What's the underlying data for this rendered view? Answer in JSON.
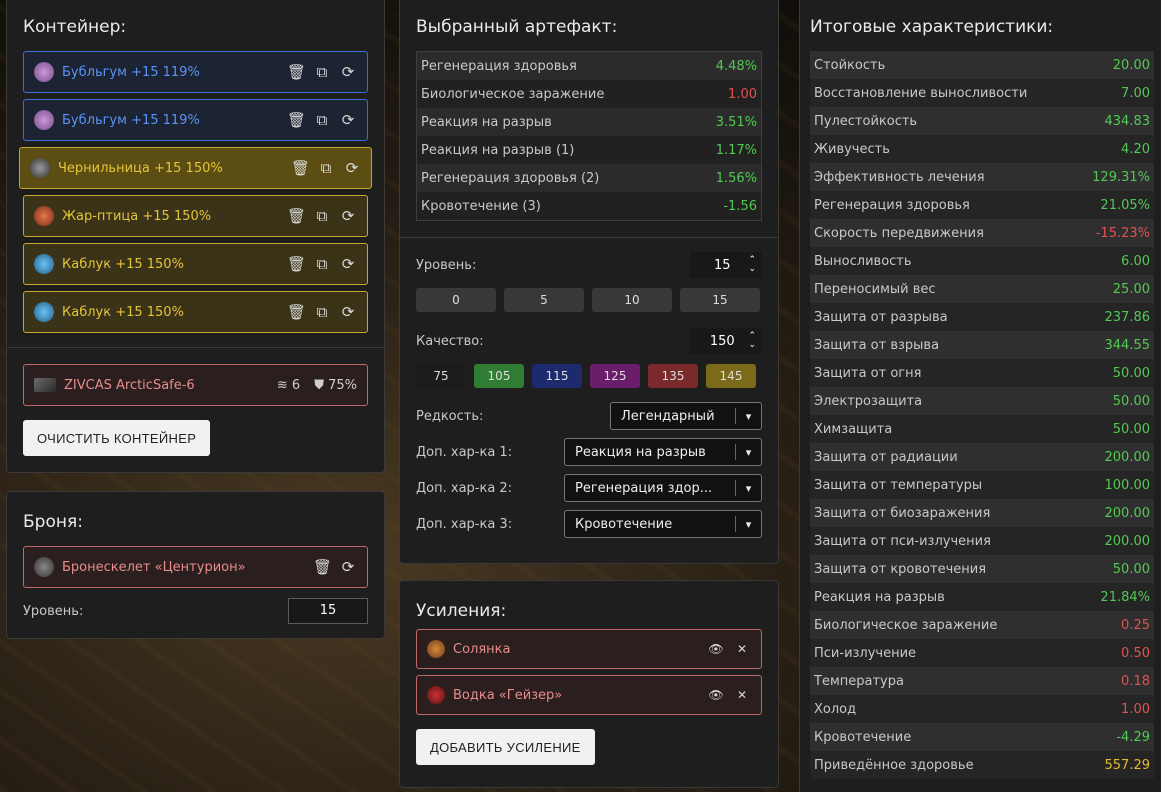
{
  "container": {
    "title": "Контейнер:",
    "artifacts": [
      {
        "name": "Бубльгум +15 119%",
        "color": "blue",
        "icon": "bubblegum-icon"
      },
      {
        "name": "Бубльгум +15 119%",
        "color": "blue",
        "icon": "bubblegum-icon"
      },
      {
        "name": "Чернильница +15 150%",
        "color": "gold",
        "icon": "inkwell-icon"
      },
      {
        "name": "Жар-птица +15 150%",
        "color": "gold",
        "icon": "firebird-icon"
      },
      {
        "name": "Каблук +15 150%",
        "color": "gold",
        "icon": "heel-icon"
      },
      {
        "name": "Каблук +15 150%",
        "color": "gold",
        "icon": "heel-icon"
      }
    ],
    "container_item": {
      "name": "ZIVCAS ArcticSafe-6",
      "slots": "6",
      "protection": "75%"
    },
    "clear_button": "ОЧИСТИТЬ КОНТЕЙНЕР"
  },
  "armor": {
    "title": "Броня:",
    "item_name": "Бронескелет «Центурион»",
    "level_label": "Уровень:",
    "level_value": "15"
  },
  "artifact": {
    "title": "Выбранный артефакт:",
    "stats": [
      {
        "name": "Регенерация здоровья",
        "value": "4.48%",
        "kind": "pos"
      },
      {
        "name": "Биологическое заражение",
        "value": "1.00",
        "kind": "neg"
      },
      {
        "name": "Реакция на разрыв",
        "value": "3.51%",
        "kind": "pos"
      },
      {
        "name": "Реакция на разрыв (1)",
        "value": "1.17%",
        "kind": "pos"
      },
      {
        "name": "Регенерация здоровья (2)",
        "value": "1.56%",
        "kind": "pos"
      },
      {
        "name": "Кровотечение (3)",
        "value": "-1.56",
        "kind": "pos"
      }
    ],
    "level_label": "Уровень:",
    "level_value": "15",
    "level_presets": [
      "0",
      "5",
      "10",
      "15"
    ],
    "quality_label": "Качество:",
    "quality_value": "150",
    "quality_presets": [
      {
        "label": "75",
        "color": "#1c1c1c"
      },
      {
        "label": "105",
        "color": "#2e7d32"
      },
      {
        "label": "115",
        "color": "#1e2a6e"
      },
      {
        "label": "125",
        "color": "#6a1d6a"
      },
      {
        "label": "135",
        "color": "#7a2a2a"
      },
      {
        "label": "145",
        "color": "#7a6a1a"
      }
    ],
    "rarity_label": "Редкость:",
    "rarity_value": "Легендарный",
    "extra1_label": "Доп. хар-ка 1:",
    "extra1_value": "Реакция на разрыв",
    "extra2_label": "Доп. хар-ка 2:",
    "extra2_value": "Регенерация здор...",
    "extra3_label": "Доп. хар-ка 3:",
    "extra3_value": "Кровотечение"
  },
  "boosts": {
    "title": "Усиления:",
    "items": [
      {
        "name": "Солянка",
        "icon": "soup-icon"
      },
      {
        "name": "Водка «Гейзер»",
        "icon": "bottle-icon"
      }
    ],
    "add_button": "ДОБАВИТЬ УСИЛЕНИЕ"
  },
  "totals": {
    "title": "Итоговые характеристики:",
    "stats": [
      {
        "name": "Стойкость",
        "value": "20.00",
        "kind": "pos"
      },
      {
        "name": "Восстановление выносливости",
        "value": "7.00",
        "kind": "pos"
      },
      {
        "name": "Пулестойкость",
        "value": "434.83",
        "kind": "pos"
      },
      {
        "name": "Живучесть",
        "value": "4.20",
        "kind": "pos"
      },
      {
        "name": "Эффективность лечения",
        "value": "129.31%",
        "kind": "pos"
      },
      {
        "name": "Регенерация здоровья",
        "value": "21.05%",
        "kind": "pos"
      },
      {
        "name": "Скорость передвижения",
        "value": "-15.23%",
        "kind": "neg"
      },
      {
        "name": "Выносливость",
        "value": "6.00",
        "kind": "pos"
      },
      {
        "name": "Переносимый вес",
        "value": "25.00",
        "kind": "pos"
      },
      {
        "name": "Защита от разрыва",
        "value": "237.86",
        "kind": "pos"
      },
      {
        "name": "Защита от взрыва",
        "value": "344.55",
        "kind": "pos"
      },
      {
        "name": "Защита от огня",
        "value": "50.00",
        "kind": "pos"
      },
      {
        "name": "Электрозащита",
        "value": "50.00",
        "kind": "pos"
      },
      {
        "name": "Химзащита",
        "value": "50.00",
        "kind": "pos"
      },
      {
        "name": "Защита от радиации",
        "value": "200.00",
        "kind": "pos"
      },
      {
        "name": "Защита от температуры",
        "value": "100.00",
        "kind": "pos"
      },
      {
        "name": "Защита от биозаражения",
        "value": "200.00",
        "kind": "pos"
      },
      {
        "name": "Защита от пси-излучения",
        "value": "200.00",
        "kind": "pos"
      },
      {
        "name": "Защита от кровотечения",
        "value": "50.00",
        "kind": "pos"
      },
      {
        "name": "Реакция на разрыв",
        "value": "21.84%",
        "kind": "pos"
      },
      {
        "name": "Биологическое заражение",
        "value": "0.25",
        "kind": "neg"
      },
      {
        "name": "Пси-излучение",
        "value": "0.50",
        "kind": "neg"
      },
      {
        "name": "Температура",
        "value": "0.18",
        "kind": "neg"
      },
      {
        "name": "Холод",
        "value": "1.00",
        "kind": "neg"
      },
      {
        "name": "Кровотечение",
        "value": "-4.29",
        "kind": "pos"
      },
      {
        "name": "Приведённое здоровье",
        "value": "557.29",
        "kind": "yellow"
      }
    ]
  }
}
